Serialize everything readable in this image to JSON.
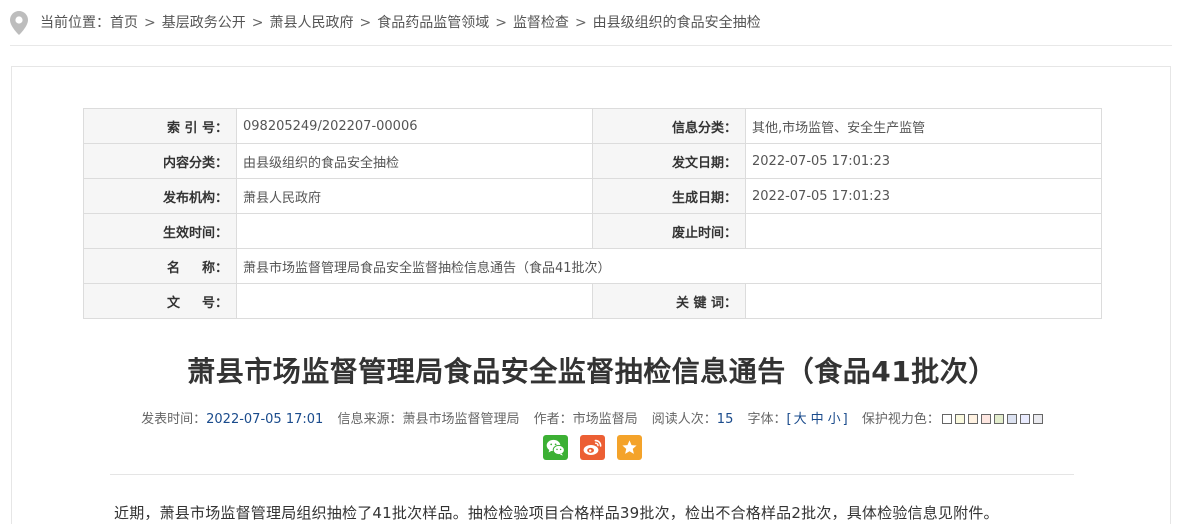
{
  "breadcrumb": {
    "prefix": "当前位置：",
    "items": [
      "首页",
      "基层政务公开",
      "萧县人民政府",
      "食品药品监管领域",
      "监督检查",
      "由县级组织的食品安全抽检"
    ],
    "separator": ">",
    "icon": "location-pin-icon"
  },
  "meta": {
    "index_label": "索 引 号：",
    "index_value": "098205249/202207-00006",
    "category_label": "信息分类：",
    "category_value": "其他,市场监管、安全生产监管",
    "content_label": "内容分类：",
    "content_value": "由县级组织的食品安全抽检",
    "date_label": "发文日期：",
    "date_value": "2022-07-05 17:01:23",
    "publisher_label": "发布机构：",
    "publisher_value": "萧县人民政府",
    "created_label": "生成日期：",
    "created_value": "2022-07-05 17:01:23",
    "effective_label": "生效时间：",
    "effective_value": "",
    "expire_label": "废止时间：",
    "expire_value": "",
    "name_label": "名 　 称：",
    "name_value": "萧县市场监督管理局食品安全监督抽检信息通告（食品41批次）",
    "docno_label": "文 　 号：",
    "docno_value": "",
    "keywords_label": "关 键 词：",
    "keywords_value": ""
  },
  "article": {
    "title": "萧县市场监督管理局食品安全监督抽检信息通告（食品41批次）",
    "publish_label": "发表时间：",
    "publish_value": "2022-07-05 17:01",
    "source_label": "信息来源：",
    "source_value": "萧县市场监督管理局",
    "author_label": "作者：",
    "author_value": "市场监督局",
    "reads_label": "阅读人次：",
    "reads_value": "15",
    "font_label": "字体：",
    "font_open": "[",
    "font_large": "大",
    "font_medium": "中",
    "font_small": "小",
    "font_close": "]",
    "eye_label": "保护视力色：",
    "body": "近期，萧县市场监督管理局组织抽检了41批次样品。抽检检验项目合格样品39批次，检出不合格样品2批次，具体检验信息见附件。"
  },
  "eye_colors": [
    "#ffffff",
    "#faf9de",
    "#fff2e2",
    "#fde6e0",
    "#e3edcd",
    "#dce2f1",
    "#e9ebfe",
    "#eaeaef"
  ],
  "share": {
    "icons": [
      "wechat-icon",
      "weibo-icon",
      "favorite-icon"
    ],
    "colors": {
      "wechat": "#3cb034",
      "weibo": "#ec5f34",
      "favorite": "#f4a32a"
    }
  }
}
